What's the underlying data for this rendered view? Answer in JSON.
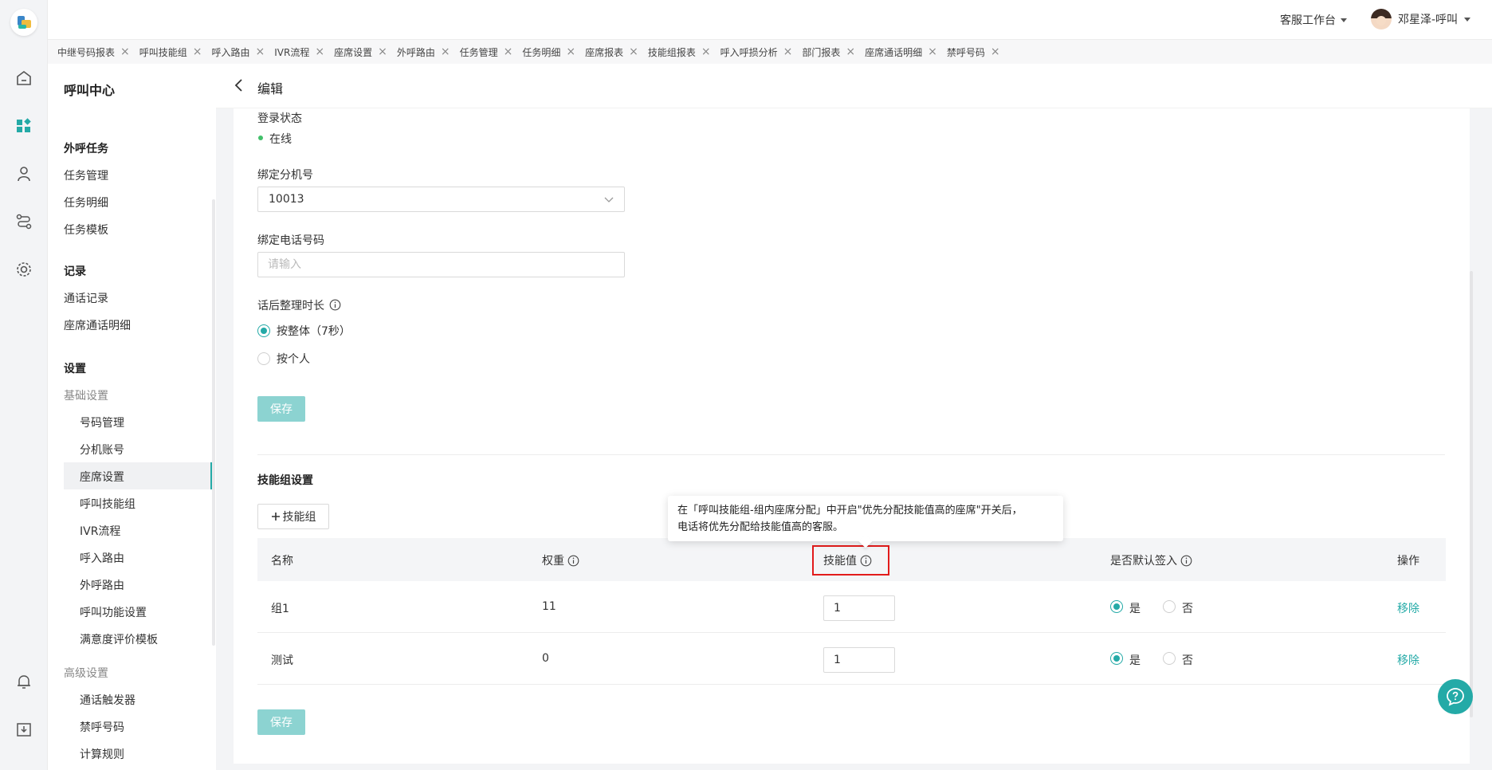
{
  "topbar": {
    "workspace": "客服工作台",
    "user": "邓星泽-呼叫"
  },
  "tabs": [
    "中继号码报表",
    "呼叫技能组",
    "呼入路由",
    "IVR流程",
    "座席设置",
    "外呼路由",
    "任务管理",
    "任务明细",
    "座席报表",
    "技能组报表",
    "呼入呼损分析",
    "部门报表",
    "座席通话明细",
    "禁呼号码"
  ],
  "menu": {
    "title": "呼叫中心",
    "group_outbound": "外呼任务",
    "task_manage": "任务管理",
    "task_detail": "任务明细",
    "task_template": "任务模板",
    "group_record": "记录",
    "call_record": "通话记录",
    "seat_call_detail": "座席通话明细",
    "group_settings": "设置",
    "basic_settings": "基础设置",
    "number_manage": "号码管理",
    "ext_account": "分机账号",
    "seat_settings": "座席设置",
    "skill_group": "呼叫技能组",
    "ivr": "IVR流程",
    "inbound_route": "呼入路由",
    "outbound_route": "外呼路由",
    "call_function": "呼叫功能设置",
    "satisfaction": "满意度评价模板",
    "advanced_settings": "高级设置",
    "call_trigger": "通话触发器",
    "blocked_numbers": "禁呼号码",
    "calc_rules": "计算规则"
  },
  "page": {
    "title": "编辑"
  },
  "form": {
    "login_status_label": "登录状态",
    "login_status_value": "在线",
    "ext_label": "绑定分机号",
    "ext_value": "10013",
    "phone_label": "绑定电话号码",
    "phone_placeholder": "请输入",
    "wrapup_label": "话后整理时长",
    "wrapup_option_all": "按整体（7秒）",
    "wrapup_option_personal": "按个人",
    "save": "保存"
  },
  "skill": {
    "section_title": "技能组设置",
    "add_button": "技能组",
    "columns": {
      "name": "名称",
      "weight": "权重",
      "skill_value": "技能值",
      "default_signin": "是否默认签入",
      "actions": "操作"
    },
    "rows": [
      {
        "name": "组1",
        "weight": "11",
        "skill_value": "1",
        "yes": "是",
        "no": "否",
        "remove": "移除"
      },
      {
        "name": "测试",
        "weight": "0",
        "skill_value": "1",
        "yes": "是",
        "no": "否",
        "remove": "移除"
      }
    ],
    "tooltip_line1": "在「呼叫技能组-组内座席分配」中开启\"优先分配技能值高的座席\"开关后，",
    "tooltip_line2": "电话将优先分配给技能值高的客服。",
    "save": "保存"
  },
  "colors": {
    "accent": "#24aaa7",
    "highlight": "#e21b1b"
  }
}
